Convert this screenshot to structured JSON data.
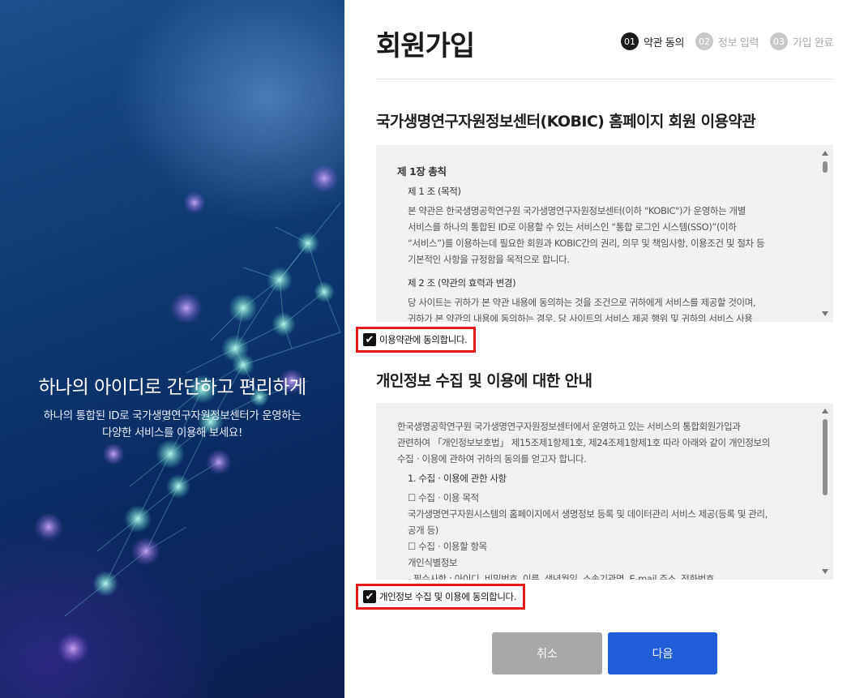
{
  "hero": {
    "title": "하나의 아이디로 간단하고 편리하게",
    "subtitle_line1": "하나의 통합된 ID로 국가생명연구자원정보센터가 운영하는",
    "subtitle_line2": "다양한 서비스를 이용해 보세요!"
  },
  "header": {
    "title": "회원가입",
    "steps": [
      {
        "num": "01",
        "label": "약관 동의",
        "active": true
      },
      {
        "num": "02",
        "label": "정보 입력",
        "active": false
      },
      {
        "num": "03",
        "label": "가입 완료",
        "active": false
      }
    ]
  },
  "terms": {
    "title": "국가생명연구자원정보센터(KOBIC) 홈페이지 회원 이용약관",
    "chapter": "제 1장 총칙",
    "article1_title": "제 1 조 (목적)",
    "article1_lines": [
      "본 약관은 한국생명공학연구원 국가생명연구자원정보센터(이하 \"KOBIC\")가 운영하는 개별",
      "서비스를 하나의 통합된 ID로 이용할 수 있는 서비스인 “통합 로그인 시스템(SSO)”(이하",
      "“서비스”)를 이용하는데 필요한 회원과 KOBIC간의 권리, 의무 및 책임사항, 이용조건 및 절차 등",
      "기본적인 사항을 규정함을 목적으로 합니다."
    ],
    "article2_title": "제 2 조 (약관의 효력과 변경)",
    "article2_lines": [
      "당 사이트는 귀하가 본 약관 내용에 동의하는 것을 조건으로 귀하에게 서비스를 제공할 것이며,",
      "귀하가 본 약관의 내용에 동의하는 경우, 당 사이트의 서비스 제공 행위 및 귀하의 서비스 사용"
    ],
    "agree_label": "이용약관에 동의합니다.",
    "agree_checked": true
  },
  "privacy": {
    "title": "개인정보 수집 및 이용에 대한 안내",
    "intro_lines": [
      "한국생명공학연구원 국가생명연구자원정보센터에서 운영하고 있는 서비스의 통합회원가입과",
      "관련하여 「개인정보보호법」 제15조제1항제1호, 제24조제1항제1호 따라 아래와 같이 개인정보의",
      "수집ㆍ이용에 관하여 귀하의 동의를 얻고자 합니다."
    ],
    "section1_title": "1. 수집ㆍ이용에 관한 사항",
    "purpose_label": "☐ 수집ㆍ이용 목적",
    "purpose_lines": [
      "국가생명연구자원시스템의 홈페이지에서 생명정보 등록 및 데이터관리 서비스 제공(등록 및 관리,",
      "공개 등)"
    ],
    "items_label": "☐ 수집ㆍ이용할 항목",
    "items_sub": "개인식별정보",
    "items_detail": "- 필수사항 : 아이디, 비밀번호, 이름, 생년월일, 소속기관명, E-mail 주소, 전화번호",
    "agree_label": "개인정보 수집 및 이용에 동의합니다.",
    "agree_checked": true
  },
  "buttons": {
    "cancel": "취소",
    "next": "다음"
  },
  "colors": {
    "primary_button": "#1f5ed6",
    "cancel_button": "#a8a8a8",
    "highlight_border": "#e31b1b",
    "active_step": "#1c1c1c",
    "inactive_step": "#c9c9c9"
  }
}
